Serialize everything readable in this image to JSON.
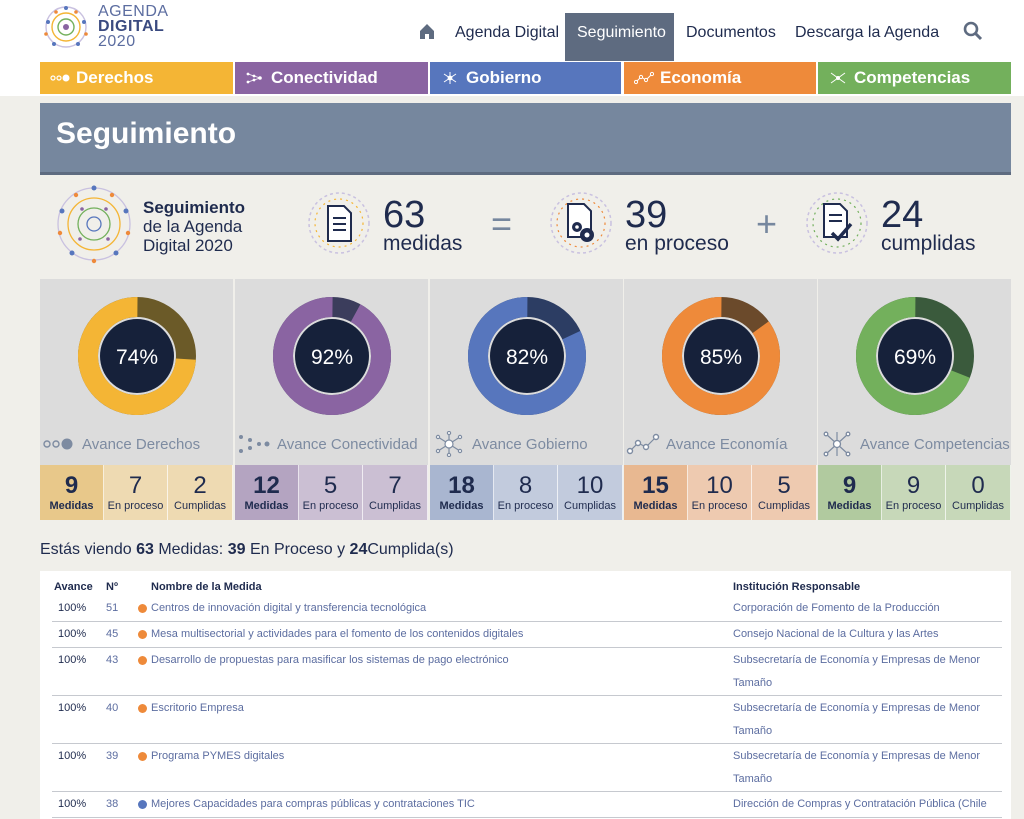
{
  "header": {
    "logo_line1": "AGENDA",
    "logo_line2": "DIGITAL",
    "logo_line3": "2020",
    "nav": [
      "Agenda Digital",
      "Seguimiento",
      "Documentos",
      "Descarga la Agenda"
    ],
    "active_nav": "Seguimiento"
  },
  "categories": [
    {
      "label": "Derechos",
      "color": "#f4b535"
    },
    {
      "label": "Conectividad",
      "color": "#8a64a2"
    },
    {
      "label": "Gobierno",
      "color": "#5776bd"
    },
    {
      "label": "Economía",
      "color": "#ee8a3a"
    },
    {
      "label": "Competencias",
      "color": "#73b05c"
    }
  ],
  "banner_title": "Seguimiento",
  "summary": {
    "title_line1": "Seguimiento",
    "title_line2": "de la Agenda",
    "title_line3": "Digital 2020",
    "total_num": "63",
    "total_label": "medidas",
    "eq": "=",
    "process_num": "39",
    "process_label": "en proceso",
    "plus": "+",
    "done_num": "24",
    "done_label": "cumplidas"
  },
  "cards": [
    {
      "percent_label": "74%",
      "percent": 74,
      "color": "#f4b535",
      "dark": "#6b5a28",
      "avance": "Avance Derechos",
      "medidas": "9",
      "proceso": "7",
      "cumplidas": "2",
      "main_bg": "#e8c88a",
      "sub_bg": "#eedab2",
      "text": "#1f2b4e"
    },
    {
      "percent_label": "92%",
      "percent": 92,
      "color": "#8a64a2",
      "dark": "#3b3d5c",
      "avance": "Avance Conectividad",
      "medidas": "12",
      "proceso": "5",
      "cumplidas": "7",
      "main_bg": "#b4a4c1",
      "sub_bg": "#cbbfd3",
      "text": "#1f2b4e"
    },
    {
      "percent_label": "82%",
      "percent": 82,
      "color": "#5776bd",
      "dark": "#2c3d63",
      "avance": "Avance Gobierno",
      "medidas": "18",
      "proceso": "8",
      "cumplidas": "10",
      "main_bg": "#a9b6d0",
      "sub_bg": "#c2cbdd",
      "text": "#1f2b4e"
    },
    {
      "percent_label": "85%",
      "percent": 85,
      "color": "#ee8a3a",
      "dark": "#6b4a2b",
      "avance": "Avance Economía",
      "medidas": "15",
      "proceso": "10",
      "cumplidas": "5",
      "main_bg": "#e8b891",
      "sub_bg": "#eecab0",
      "text": "#1f2b4e"
    },
    {
      "percent_label": "69%",
      "percent": 69,
      "color": "#73b05c",
      "dark": "#3a5a3c",
      "avance": "Avance Competencias",
      "medidas": "9",
      "proceso": "9",
      "cumplidas": "0",
      "main_bg": "#b1ca9f",
      "sub_bg": "#c7d8b9",
      "text": "#1f2b4e"
    }
  ],
  "stat_labels": {
    "medidas": "Medidas",
    "proceso": "En proceso",
    "cumplidas": "Cumplidas"
  },
  "viewing": {
    "pre": "Estás viendo",
    "total": "63",
    "mid1": "Medidas:",
    "proceso": "39",
    "mid2": "En Proceso y",
    "cumplidas": "24",
    "post": "Cumplida(s)"
  },
  "table": {
    "headers": {
      "avance": "Avance",
      "no": "Nº",
      "name": "Nombre de la Medida",
      "inst": "Institución Responsable"
    },
    "rows": [
      {
        "avance": "100%",
        "no": "51",
        "dot": "#ee8a3a",
        "name": "Centros de innovación digital y transferencia tecnológica",
        "inst": "Corporación de Fomento de la Producción",
        "lines": 1
      },
      {
        "avance": "100%",
        "no": "45",
        "dot": "#ee8a3a",
        "name": "Mesa multisectorial y actividades para el fomento de los contenidos digitales",
        "inst": "Consejo Nacional de la Cultura y las Artes",
        "lines": 1
      },
      {
        "avance": "100%",
        "no": "43",
        "dot": "#ee8a3a",
        "name": "Desarrollo de propuestas para masificar los sistemas de pago electrónico",
        "inst": "Subsecretaría de Economía y Empresas de Menor Tamaño",
        "lines": 2
      },
      {
        "avance": "100%",
        "no": "40",
        "dot": "#ee8a3a",
        "name": "Escritorio Empresa",
        "inst": "Subsecretaría de Economía y Empresas de Menor Tamaño",
        "lines": 2
      },
      {
        "avance": "100%",
        "no": "39",
        "dot": "#ee8a3a",
        "name": "Programa PYMES digitales",
        "inst": "Subsecretaría de Economía y Empresas de Menor Tamaño",
        "lines": 2
      },
      {
        "avance": "100%",
        "no": "38",
        "dot": "#5776bd",
        "name": "Mejores Capacidades para compras públicas y contrataciones TIC",
        "inst": "Dirección de Compras y Contratación Pública (Chile",
        "lines": 1
      }
    ]
  }
}
